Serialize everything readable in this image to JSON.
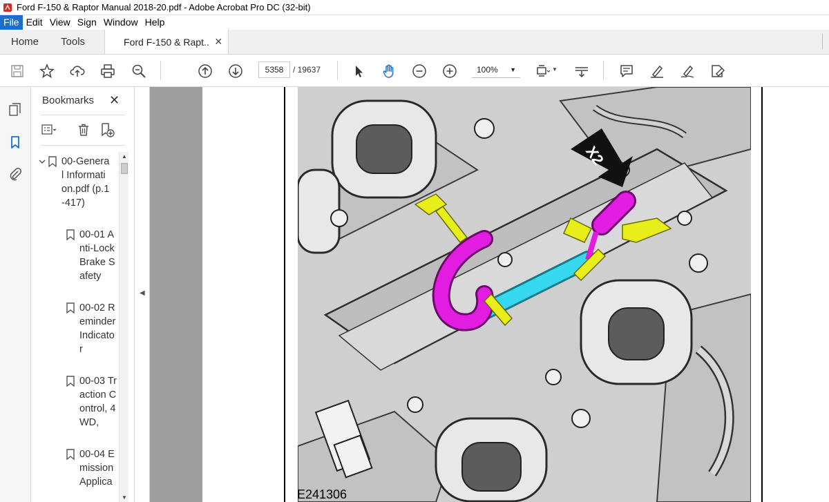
{
  "window": {
    "title": "Ford F-150 & Raptor Manual 2018-20.pdf - Adobe Acrobat Pro DC (32-bit)"
  },
  "menu": [
    "File",
    "Edit",
    "View",
    "Sign",
    "Window",
    "Help"
  ],
  "tabs": {
    "home": "Home",
    "tools": "Tools",
    "document": "Ford F-150 & Rapt..."
  },
  "toolbar": {
    "page_current": "5358",
    "page_total": "/ 19637",
    "zoom": "100%",
    "icons": [
      "save-icon",
      "bookmark-star-icon",
      "upload-icon",
      "print-icon",
      "search-zoom-icon",
      "page-up-icon",
      "page-down-icon",
      "select-arrow-icon",
      "hand-icon",
      "zoom-out-icon",
      "zoom-in-icon",
      "page-fit-icon",
      "scroll-mode-icon",
      "comment-icon",
      "highlight-icon",
      "sign-icon",
      "fill-sign-icon"
    ]
  },
  "bookmarks": {
    "title": "Bookmarks",
    "items": [
      {
        "label": "00-General Information.pdf (p.1-417)",
        "level": 0,
        "expanded": true
      },
      {
        "label": "00-01 Anti-Lock Brake Safety",
        "level": 1
      },
      {
        "label": "00-02 Reminder Indicator",
        "level": 1
      },
      {
        "label": "00-03 Traction Control, 4WD,",
        "level": 1
      },
      {
        "label": "00-04 Emission Applica",
        "level": 1
      }
    ]
  },
  "figure": {
    "label": "E241306",
    "callout": "X2",
    "colors": {
      "magenta": "#e21ce0",
      "cyan": "#36d8f0",
      "yellow": "#e8ee1a"
    }
  }
}
